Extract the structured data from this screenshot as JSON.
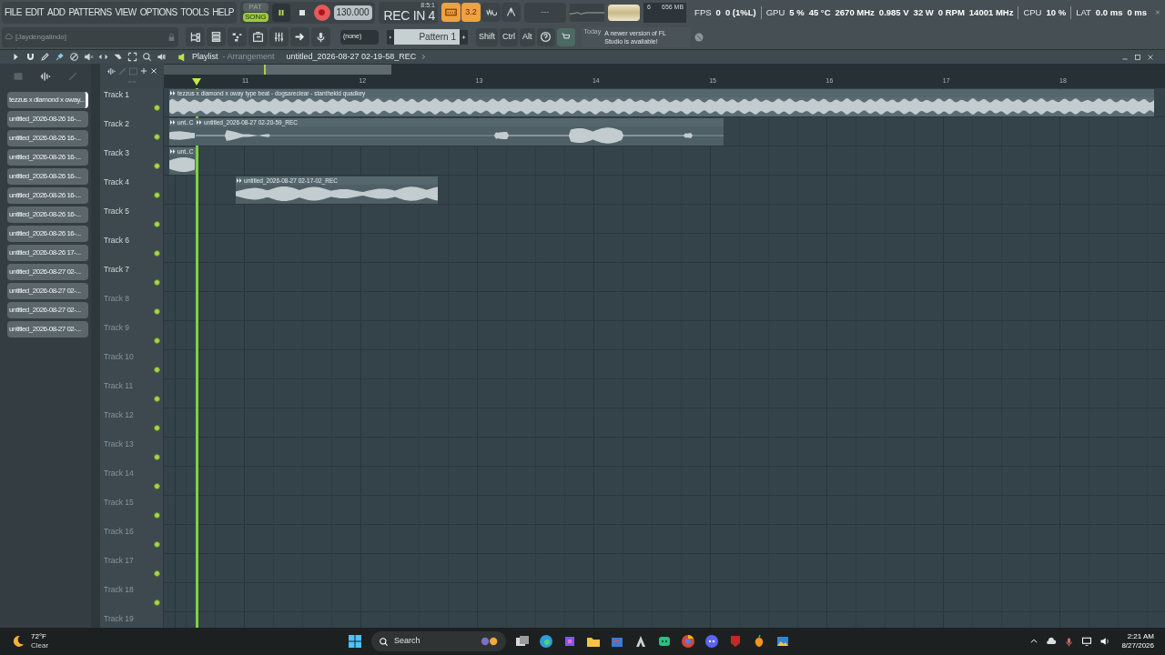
{
  "menu": [
    "FILE",
    "EDIT",
    "ADD",
    "PATTERNS",
    "VIEW",
    "OPTIONS",
    "TOOLS",
    "HELP"
  ],
  "transport": {
    "modes": [
      {
        "label": "PAT",
        "selected": false
      },
      {
        "label": "SONG",
        "selected": true
      }
    ],
    "playing": true,
    "recording": true,
    "tempo": "130.000"
  },
  "song_position": "8:5:1",
  "rec_label": "REC IN 4",
  "toggles": [
    {
      "kind": "typing",
      "on": true
    },
    {
      "kind": "countdown",
      "label": "3.2",
      "on": true
    },
    {
      "kind": "loop",
      "on": false
    },
    {
      "kind": "metronome",
      "on": false
    }
  ],
  "hint_display": "---",
  "memory": {
    "cpu": "6",
    "ram": "656 MB"
  },
  "stats": [
    {
      "label": "FPS",
      "values": [
        "0",
        "0 (1%L)"
      ]
    },
    {
      "label": "GPU",
      "values": [
        "5 %",
        "45 °C",
        "2670 MHz",
        "0.985 V",
        "32 W",
        "0 RPM",
        "14001 MHz"
      ]
    },
    {
      "label": "CPU",
      "values": [
        "10 %"
      ]
    },
    {
      "label": "LAT",
      "values": [
        "0.0 ms",
        "0 ms"
      ]
    }
  ],
  "user": "[Jaydengalindo]",
  "channel_selector": "(none)",
  "pattern_selector": "Pattern 1",
  "modifier_keys": [
    "Shift",
    "Ctrl",
    "Alt"
  ],
  "news": {
    "date": "Today",
    "message": "A newer version of FL Studio is available!"
  },
  "playlist": {
    "title": "Playlist",
    "view": "- Arrangement",
    "clip_source": "untitled_2026-08-27 02-19-58_REC",
    "ruler": [
      "11",
      "12",
      "13",
      "14",
      "15",
      "16",
      "17",
      "18"
    ],
    "browser": [
      {
        "label": "tezzus x diamond x oway...",
        "selected": true
      },
      {
        "label": "untitled_2026-08-26 16-...",
        "selected": false
      },
      {
        "label": "untitled_2026-08-26 16-...",
        "selected": false
      },
      {
        "label": "untitled_2026-08-26 16-...",
        "selected": false
      },
      {
        "label": "untitled_2026-08-26 16-...",
        "selected": false
      },
      {
        "label": "untitled_2026-08-26 16-...",
        "selected": false
      },
      {
        "label": "untitled_2026-08-26 16-...",
        "selected": false
      },
      {
        "label": "untitled_2026-08-26 16-...",
        "selected": false
      },
      {
        "label": "untitled_2026-08-26 17-...",
        "selected": false
      },
      {
        "label": "untitled_2026-08-27 02-...",
        "selected": false
      },
      {
        "label": "untitled_2026-08-27 02-...",
        "selected": false
      },
      {
        "label": "untitled_2026-08-27 02-...",
        "selected": false
      },
      {
        "label": "untitled_2026-08-27 02-...",
        "selected": false
      }
    ],
    "tracks": [
      {
        "name": "Track 1",
        "active": true,
        "clips": [
          {
            "label": "tezzus x diamond x oway type beat - dogsareclear - stanthekid quadkey"
          }
        ]
      },
      {
        "name": "Track 2",
        "active": true,
        "clips": [
          {
            "label": "unt..C"
          },
          {
            "label": "untitled_2026-08-27 02-20-59_REC"
          }
        ]
      },
      {
        "name": "Track 3",
        "active": true,
        "clips": [
          {
            "label": "unt..C"
          }
        ]
      },
      {
        "name": "Track 4",
        "active": true,
        "clips": [
          {
            "label": "untitled_2026-08-27 02-17-02_REC"
          }
        ]
      },
      {
        "name": "Track 5",
        "active": true
      },
      {
        "name": "Track 6",
        "active": true
      },
      {
        "name": "Track 7",
        "active": true
      },
      {
        "name": "Track 8",
        "active": false
      },
      {
        "name": "Track 9",
        "active": false
      },
      {
        "name": "Track 10",
        "active": false
      },
      {
        "name": "Track 11",
        "active": false
      },
      {
        "name": "Track 12",
        "active": false
      },
      {
        "name": "Track 13",
        "active": false
      },
      {
        "name": "Track 14",
        "active": false
      },
      {
        "name": "Track 15",
        "active": false
      },
      {
        "name": "Track 16",
        "active": false
      },
      {
        "name": "Track 17",
        "active": false
      },
      {
        "name": "Track 18",
        "active": false
      },
      {
        "name": "Track 19",
        "active": false
      }
    ]
  },
  "taskbar": {
    "temperature": "72°F",
    "condition": "Clear",
    "search": "Search",
    "time": "2:21 AM",
    "date": "8/27/2026"
  }
}
